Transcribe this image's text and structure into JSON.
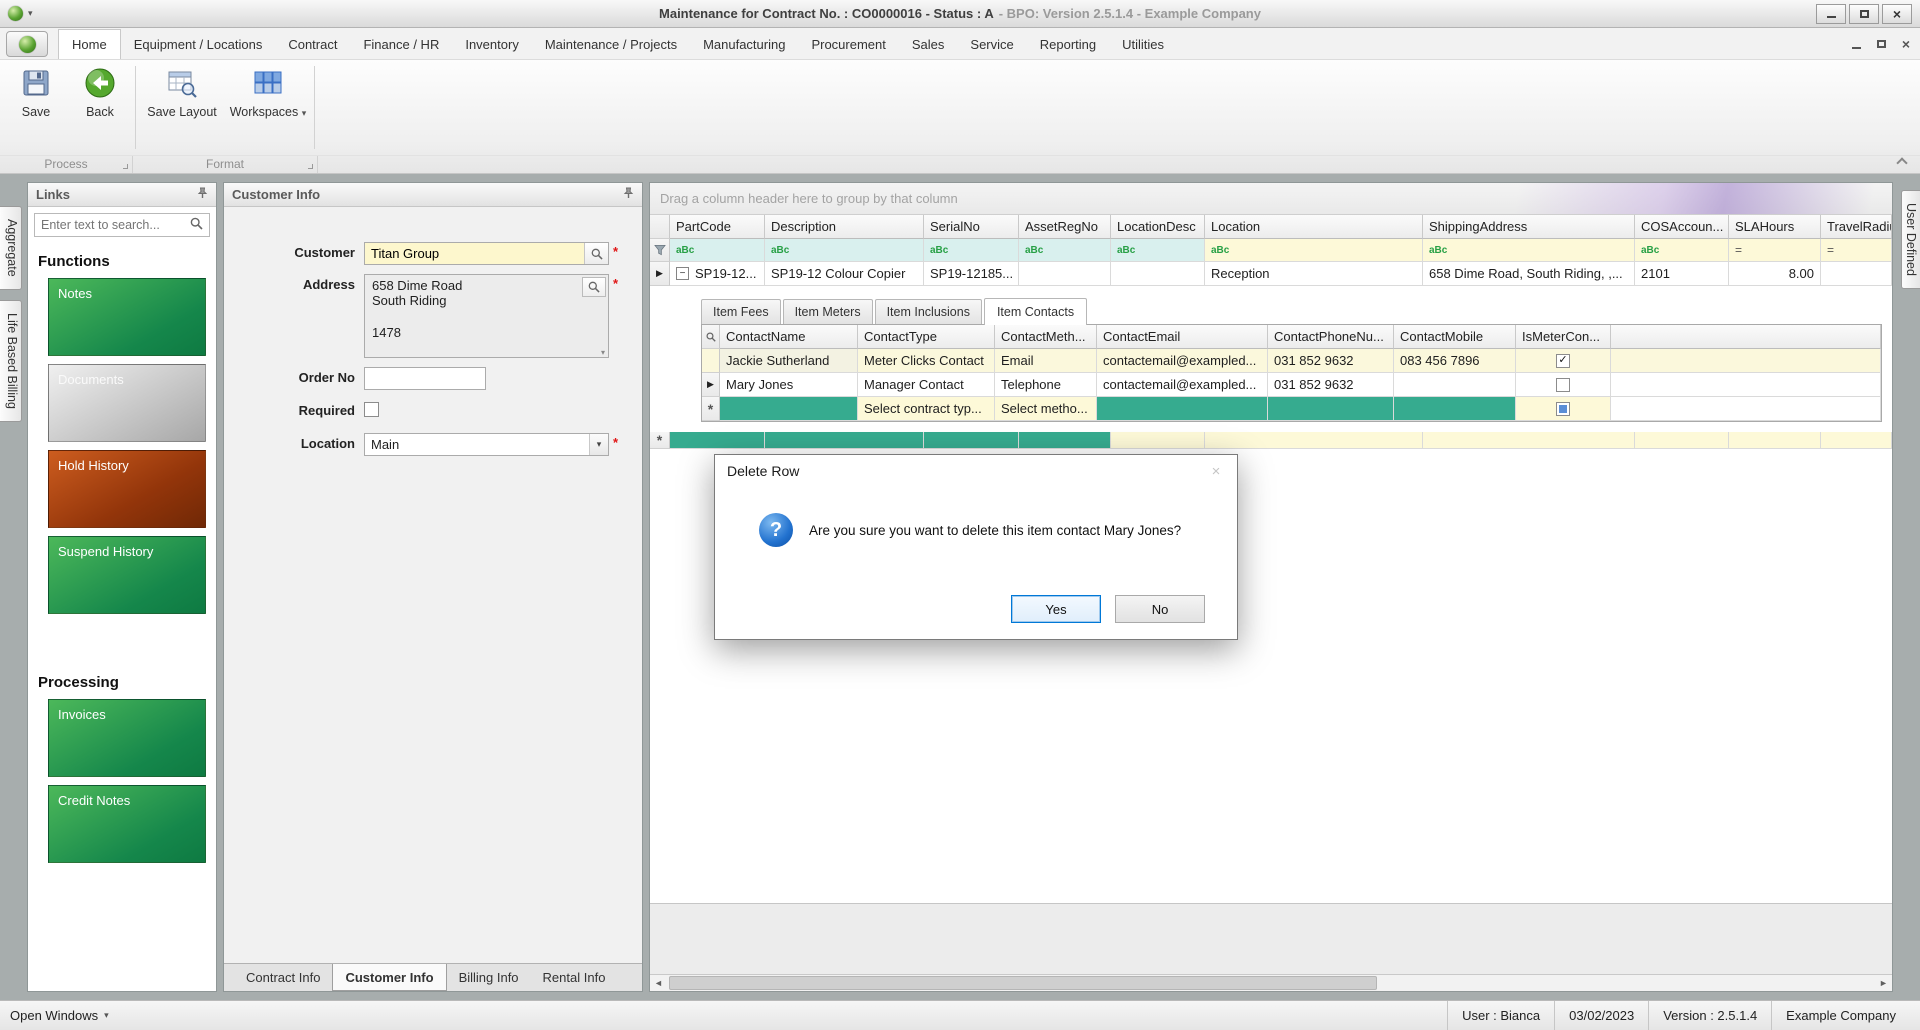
{
  "window": {
    "title_main": "Maintenance for Contract No. : CO0000016 - Status : A",
    "title_suffix": "- BPO: Version 2.5.1.4 - Example Company"
  },
  "glyphs": {
    "caret_down": "▾",
    "row_arrow": "▶",
    "minus": "−",
    "asterisk": "*",
    "close": "×",
    "check": "✓",
    "question": "?",
    "left_arrow": "◄",
    "right_arrow": "►"
  },
  "menubar": {
    "tabs": [
      "Home",
      "Equipment / Locations",
      "Contract",
      "Finance / HR",
      "Inventory",
      "Maintenance / Projects",
      "Manufacturing",
      "Procurement",
      "Sales",
      "Service",
      "Reporting",
      "Utilities"
    ],
    "active_tab": "Home"
  },
  "ribbon": {
    "save": "Save",
    "back": "Back",
    "save_layout": "Save Layout",
    "workspaces": "Workspaces",
    "groups": [
      "Process",
      "Format"
    ]
  },
  "edges": {
    "left": [
      "Aggregate",
      "Life Based Billing"
    ],
    "right": [
      "User Defined"
    ]
  },
  "links": {
    "title": "Links",
    "search_placeholder": "Enter text to search...",
    "functions_heading": "Functions",
    "processing_heading": "Processing",
    "buttons": {
      "notes": "Notes",
      "documents": "Documents",
      "hold_history": "Hold History",
      "suspend_history": "Suspend History",
      "invoices": "Invoices",
      "credit_notes": "Credit Notes"
    }
  },
  "customer": {
    "panel_title": "Customer Info",
    "labels": {
      "customer": "Customer",
      "address": "Address",
      "order_no": "Order No",
      "required": "Required",
      "location": "Location"
    },
    "values": {
      "customer": "Titan Group",
      "address_lines": [
        "658 Dime Road",
        "South Riding",
        "1478"
      ],
      "order_no": "",
      "required_checked": false,
      "location": "Main"
    },
    "required_marker": "*",
    "tabs": [
      "Contract Info",
      "Customer Info",
      "Billing Info",
      "Rental Info"
    ],
    "active_tab": "Customer Info"
  },
  "grid": {
    "group_hint": "Drag a column header here to group by that column",
    "columns": [
      "PartCode",
      "Description",
      "SerialNo",
      "AssetRegNo",
      "LocationDesc",
      "Location",
      "ShippingAddress",
      "COSAccoun...",
      "SLAHours",
      "TravelRadiu..."
    ],
    "filter": {
      "abc": "aBc",
      "eq": "="
    },
    "row_cells": [
      "SP19-12...",
      "SP19-12 Colour Copier",
      "SP19-12185...",
      "",
      "",
      "Reception",
      "658 Dime Road, South Riding, ,...",
      "2101",
      "8.00",
      ""
    ]
  },
  "detail": {
    "tabs": [
      "Item Fees",
      "Item Meters",
      "Item Inclusions",
      "Item Contacts"
    ],
    "active_tab": "Item Contacts",
    "columns": [
      "ContactName",
      "ContactType",
      "ContactMeth...",
      "ContactEmail",
      "ContactPhoneNu...",
      "ContactMobile",
      "IsMeterCon..."
    ],
    "rows": [
      {
        "cells": [
          "Jackie Sutherland",
          "Meter Clicks Contact",
          "Email",
          "contactemail@exampled...",
          "031 852 9632",
          "083 456 7896"
        ],
        "is_meter_contact": true
      },
      {
        "cells": [
          "Mary Jones",
          "Manager Contact",
          "Telephone",
          "contactemail@exampled...",
          "031 852 9632",
          ""
        ],
        "is_meter_contact": false
      }
    ],
    "new_row": {
      "cells": [
        "",
        "Select contract typ...",
        "Select metho...",
        "",
        "",
        ""
      ],
      "is_meter_contact": null
    }
  },
  "dialog": {
    "title": "Delete Row",
    "message": "Are you sure you want to delete this item contact Mary Jones?",
    "yes": "Yes",
    "no": "No"
  },
  "statusbar": {
    "open_windows": "Open Windows",
    "user": "User : Bianca",
    "date": "03/02/2023",
    "version": "Version : 2.5.1.4",
    "company": "Example Company"
  },
  "colors": {
    "new_row_teal": "#36ab8f",
    "filter_cyan": "#d9f0ee",
    "cell_yellow": "#fdf9d8",
    "button_green": "#15874b",
    "button_orange": "#93350a",
    "focus_blue": "#0078d7"
  }
}
